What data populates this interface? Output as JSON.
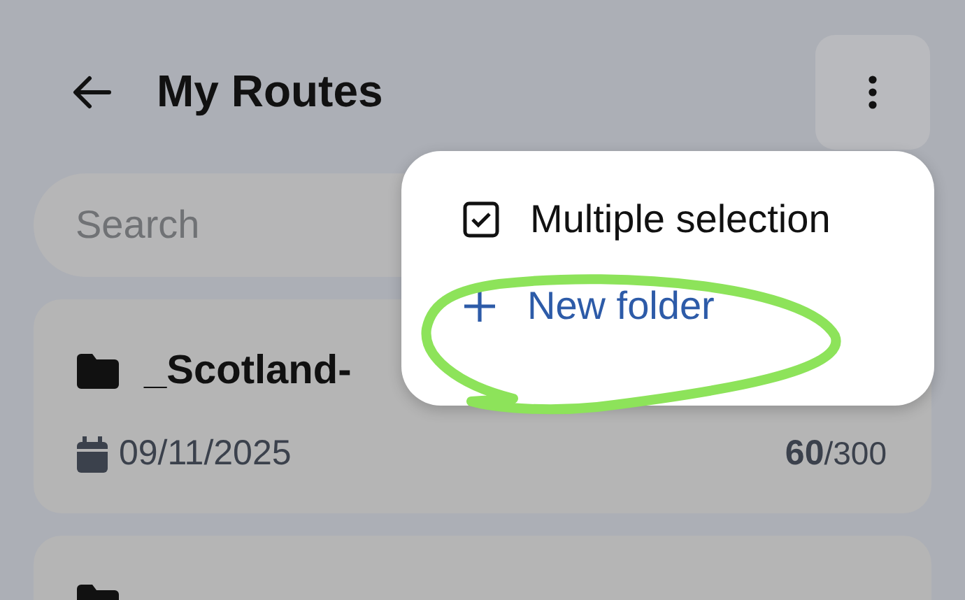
{
  "header": {
    "title": "My Routes"
  },
  "search": {
    "placeholder": "Search"
  },
  "folders": [
    {
      "kind": "folder",
      "name": "_Scotland-",
      "date": "09/11/2025",
      "count": "**60**/300"
    },
    {
      "kind": "folder"
    }
  ],
  "menu": {
    "items": [
      {
        "kind": "checkbox",
        "label": "Multiple selection",
        "checked": true
      },
      {
        "kind": "action",
        "label": "New folder"
      }
    ]
  },
  "annotation": {
    "kind": "ellipse"
  }
}
